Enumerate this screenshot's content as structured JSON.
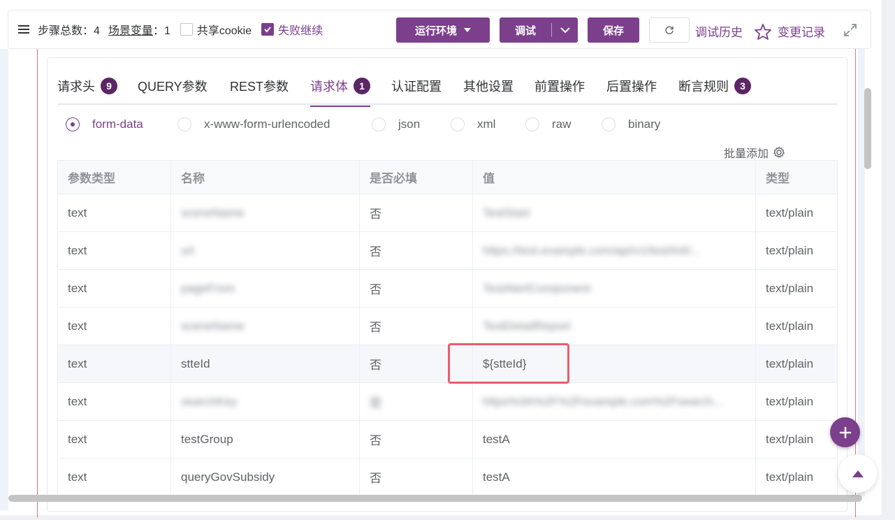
{
  "toolbar": {
    "steps_label": "步骤总数：",
    "steps_value": "4",
    "scene_vars_label": "场景变量",
    "scene_vars_sep": "：",
    "scene_vars_value": "1",
    "share_cookie_label": "共享cookie",
    "share_cookie_checked": false,
    "fail_continue_label": "失败继续",
    "fail_continue_checked": true,
    "run_env_label": "运行环境",
    "debug_label": "调试",
    "save_label": "保存",
    "debug_history_label": "调试历史",
    "change_log_label": "变更记录"
  },
  "tabs": [
    {
      "label": "请求头",
      "badge": "9"
    },
    {
      "label": "QUERY参数",
      "badge": ""
    },
    {
      "label": "REST参数",
      "badge": ""
    },
    {
      "label": "请求体",
      "badge": "1",
      "active": true
    },
    {
      "label": "认证配置",
      "badge": ""
    },
    {
      "label": "其他设置",
      "badge": ""
    },
    {
      "label": "前置操作",
      "badge": ""
    },
    {
      "label": "后置操作",
      "badge": ""
    },
    {
      "label": "断言规则",
      "badge": "3"
    }
  ],
  "body_types": [
    {
      "label": "form-data",
      "selected": true
    },
    {
      "label": "x-www-form-urlencoded",
      "selected": false
    },
    {
      "label": "json",
      "selected": false
    },
    {
      "label": "xml",
      "selected": false
    },
    {
      "label": "raw",
      "selected": false
    },
    {
      "label": "binary",
      "selected": false
    }
  ],
  "bulk_add_label": "批量添加",
  "table": {
    "headers": [
      "参数类型",
      "名称",
      "是否必填",
      "值",
      "类型"
    ],
    "rows": [
      {
        "param_type": "text",
        "name": "sceneName",
        "required": "否",
        "value": "TestStart",
        "type": "text/plain"
      },
      {
        "param_type": "text",
        "name": "url",
        "required": "否",
        "value": "https://test.example.com/api/v1/test/init/...",
        "type": "text/plain"
      },
      {
        "param_type": "text",
        "name": "pageFrom",
        "required": "否",
        "value": "TestAlertComponent",
        "type": "text/plain"
      },
      {
        "param_type": "text",
        "name": "sceneName",
        "required": "否",
        "value": "TestDetailReport",
        "type": "text/plain"
      },
      {
        "param_type": "text",
        "name": "stteId",
        "required": "否",
        "value": "${stteId}",
        "type": "text/plain"
      },
      {
        "param_type": "text",
        "name": "searchKey",
        "required": "是",
        "value": "https%3A%2F%2Fexample.com%2Fsearch...",
        "type": "text/plain"
      },
      {
        "param_type": "text",
        "name": "testGroup",
        "required": "否",
        "value": "testA",
        "type": "text/plain"
      },
      {
        "param_type": "text",
        "name": "queryGovSubsidy",
        "required": "否",
        "value": "testA",
        "type": "text/plain"
      }
    ]
  },
  "colors": {
    "accent": "#7b3f8c",
    "badge": "#5b2566",
    "highlight": "#ee5b6b"
  }
}
